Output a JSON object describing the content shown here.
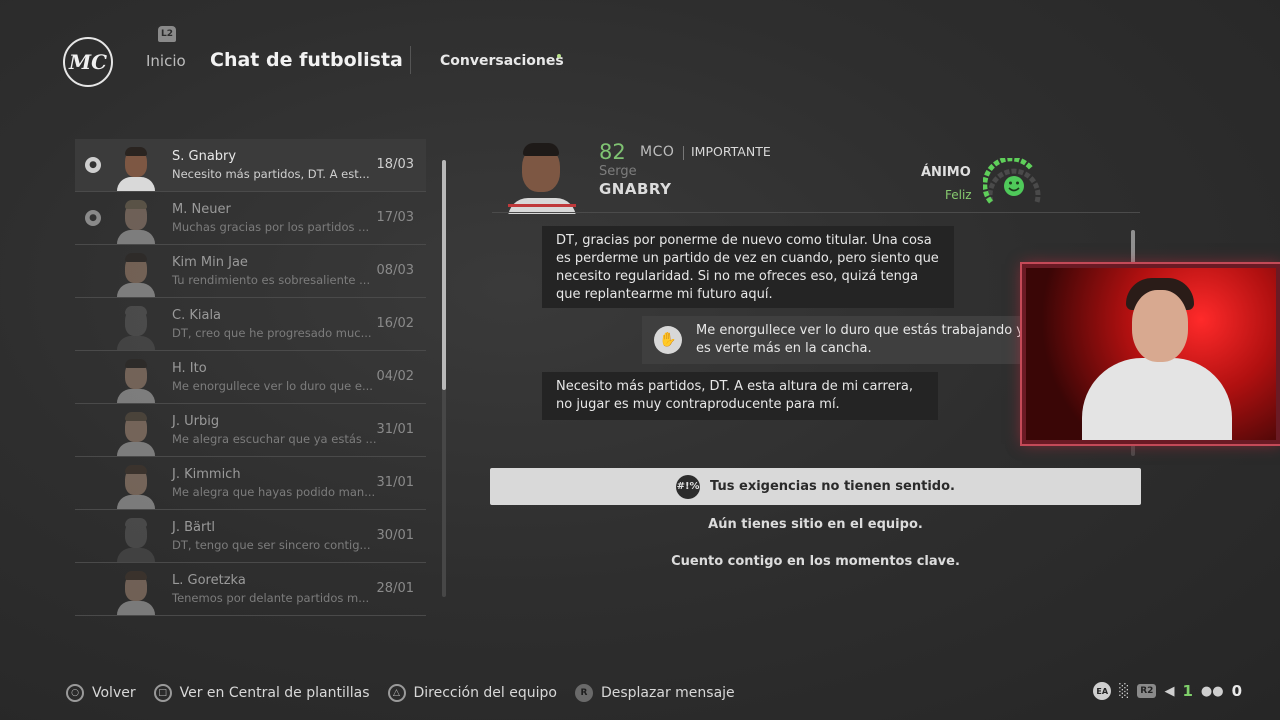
{
  "header": {
    "logo_text": "MC",
    "l2_badge": "L2",
    "home_label": "Inicio",
    "title": "Chat de futbolista",
    "conversations_tab": "Conversaciones"
  },
  "conversations": [
    {
      "name": "S. Gnabry",
      "preview": "Necesito más partidos, DT. A est...",
      "date": "18/03",
      "icon": "chat-bubble-icon"
    },
    {
      "name": "M. Neuer",
      "preview": "Muchas gracias por los partidos ...",
      "date": "17/03",
      "icon": "chat-bubble-icon"
    },
    {
      "name": "Kim Min Jae",
      "preview": "Tu rendimiento es sobresaliente ...",
      "date": "08/03"
    },
    {
      "name": "C. Kiala",
      "preview": "DT, creo que he progresado muc...",
      "date": "16/02"
    },
    {
      "name": "H. Ito",
      "preview": "Me enorgullece ver lo duro que e...",
      "date": "04/02"
    },
    {
      "name": "J. Urbig",
      "preview": "Me alegra escuchar que ya estás ...",
      "date": "31/01"
    },
    {
      "name": "J. Kimmich",
      "preview": "Me alegra que hayas podido man...",
      "date": "31/01"
    },
    {
      "name": "J. Bärtl",
      "preview": "DT, tengo que ser sincero contig...",
      "date": "30/01"
    },
    {
      "name": "L. Goretzka",
      "preview": "Tenemos por delante partidos m...",
      "date": "28/01"
    }
  ],
  "player": {
    "rating": "82",
    "position": "MCO",
    "status": "IMPORTANTE",
    "first_name": "Serge",
    "last_name": "GNABRY",
    "mood_label": "ÁNIMO",
    "mood_value": "Feliz",
    "mood_icon": "smiley-face-icon"
  },
  "messages": [
    {
      "from": "player",
      "text": "DT, gracias por ponerme de nuevo como titular. Una cosa es perderme un partido de vez en cuando, pero siento que necesito regularidad. Si no me ofreces eso, quizá tenga que replantearme mi futuro aquí."
    },
    {
      "from": "manager",
      "text": "Me enorgullece ver lo duro que estás trabajando y es verte más en la cancha.",
      "icon": "applause-icon"
    },
    {
      "from": "player",
      "text": "Necesito más partidos, DT. A esta altura de mi carrera, no jugar es muy contraproducente para mí."
    }
  ],
  "replies": [
    {
      "text": "Tus exigencias no tienen sentido.",
      "selected": true,
      "icon": "angry-symbols-icon",
      "icon_text": "#!%"
    },
    {
      "text": "Aún tienes sitio en el equipo."
    },
    {
      "text": "Cuento contigo en los momentos clave."
    }
  ],
  "footer": {
    "back": "Volver",
    "squad_hub": "Ver en Central de plantillas",
    "team_direction": "Dirección del equipo",
    "scroll_message": "Desplazar mensaje",
    "r_glyph": "R"
  },
  "status_bar": {
    "ea": "EA",
    "r2": "R2",
    "green_count": "1",
    "friends_count": "0"
  },
  "colors": {
    "rating_green": "#7fc272",
    "mood_green": "#86c96f",
    "selected_reply_bg": "#d9d9d9"
  }
}
